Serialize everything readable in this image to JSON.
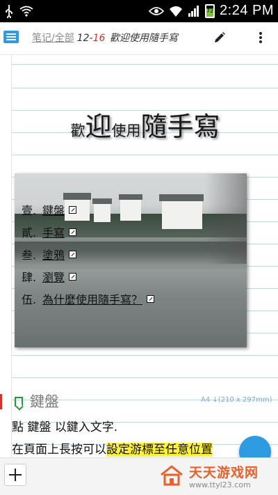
{
  "statusbar": {
    "time": "2:24 PM",
    "battery_level": "72",
    "icons": [
      "usb-icon",
      "wifi-icon",
      "eye-icon",
      "wifi-icon",
      "signal-icon",
      "battery-icon"
    ]
  },
  "appbar": {
    "breadcrumb": "笔记/全部",
    "date_prefix": "12-",
    "date_suffix": "16",
    "note_title": "歡迎使用隨手寫"
  },
  "page": {
    "welcome": {
      "p1": "歡",
      "p2": "迎",
      "p3": "使用",
      "p4": "隨手寫"
    },
    "links": [
      {
        "num": "壹.",
        "label": "鍵盤"
      },
      {
        "num": "貳.",
        "label": "手寫"
      },
      {
        "num": "叁.",
        "label": "塗鴉"
      },
      {
        "num": "肆.",
        "label": "瀏覽"
      },
      {
        "num": "伍.",
        "label": "為什麼使用隨手寫？"
      }
    ],
    "section": {
      "title": "鍵盤",
      "paper_size": "A4 ↓(210 x 297mm)",
      "line1": "點 鍵盤 以鍵入文字.",
      "line2_plain": "在頁面上長按可以",
      "line2_highlight": "設定游標至任意位置"
    }
  },
  "watermark": {
    "name": "天天游戏网",
    "url": "www.ttyl23.com"
  },
  "colors": {
    "accent": "#2e9be0",
    "highlight": "#fff23a",
    "bookmark": "#1e9a3c",
    "date_red": "#d0342c"
  }
}
